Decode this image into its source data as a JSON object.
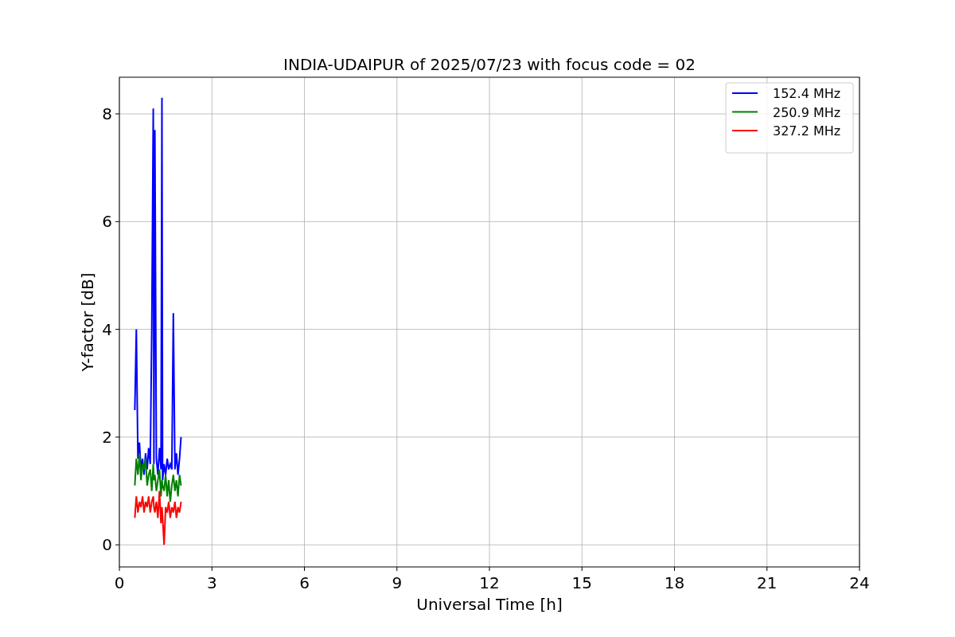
{
  "figure": {
    "chart_data": {
      "type": "line",
      "title": "INDIA-UDAIPUR of 2025/07/23 with focus code = 02",
      "xlabel": "Universal Time [h]",
      "ylabel": "Y-factor [dB]",
      "x": [
        0.5,
        0.55,
        0.6,
        0.65,
        0.7,
        0.75,
        0.8,
        0.85,
        0.9,
        0.95,
        1.0,
        1.05,
        1.1,
        1.12,
        1.15,
        1.2,
        1.25,
        1.3,
        1.35,
        1.38,
        1.4,
        1.45,
        1.5,
        1.55,
        1.6,
        1.65,
        1.7,
        1.75,
        1.8,
        1.85,
        1.9,
        1.95,
        2.0
      ],
      "series": [
        {
          "name": "152.4 MHz",
          "color": "#0000ff",
          "values": [
            2.5,
            4.0,
            1.6,
            1.9,
            1.4,
            1.6,
            1.3,
            1.7,
            1.4,
            1.8,
            1.5,
            4.0,
            8.1,
            1.5,
            7.7,
            1.6,
            1.3,
            1.8,
            1.4,
            8.3,
            1.2,
            1.5,
            1.3,
            1.6,
            1.4,
            1.5,
            1.4,
            4.3,
            1.4,
            1.7,
            1.3,
            1.6,
            2.0
          ]
        },
        {
          "name": "250.9 MHz",
          "color": "#008000",
          "values": [
            1.1,
            1.6,
            1.3,
            1.7,
            1.2,
            1.5,
            1.4,
            1.6,
            1.1,
            1.3,
            1.4,
            1.0,
            1.5,
            1.2,
            1.3,
            1.0,
            1.2,
            1.4,
            0.9,
            1.2,
            1.1,
            1.0,
            1.3,
            0.9,
            1.2,
            0.8,
            1.1,
            1.3,
            1.0,
            1.2,
            0.9,
            1.3,
            1.1
          ]
        },
        {
          "name": "327.2 MHz",
          "color": "#ff0000",
          "values": [
            0.5,
            0.9,
            0.6,
            0.8,
            0.7,
            0.9,
            0.6,
            0.8,
            0.7,
            0.9,
            0.6,
            0.8,
            0.9,
            0.7,
            0.6,
            0.8,
            0.5,
            1.0,
            0.4,
            0.7,
            0.5,
            0.0,
            0.7,
            0.6,
            0.8,
            0.5,
            0.7,
            0.6,
            0.8,
            0.5,
            0.7,
            0.6,
            0.8
          ]
        }
      ],
      "grid": true,
      "legend": true,
      "xlim": [
        0,
        24
      ],
      "ylim": [
        -0.41,
        8.68
      ],
      "xticks": [
        0,
        3,
        6,
        9,
        12,
        15,
        18,
        21,
        24
      ],
      "yticks": [
        0,
        2,
        4,
        6,
        8
      ]
    }
  }
}
